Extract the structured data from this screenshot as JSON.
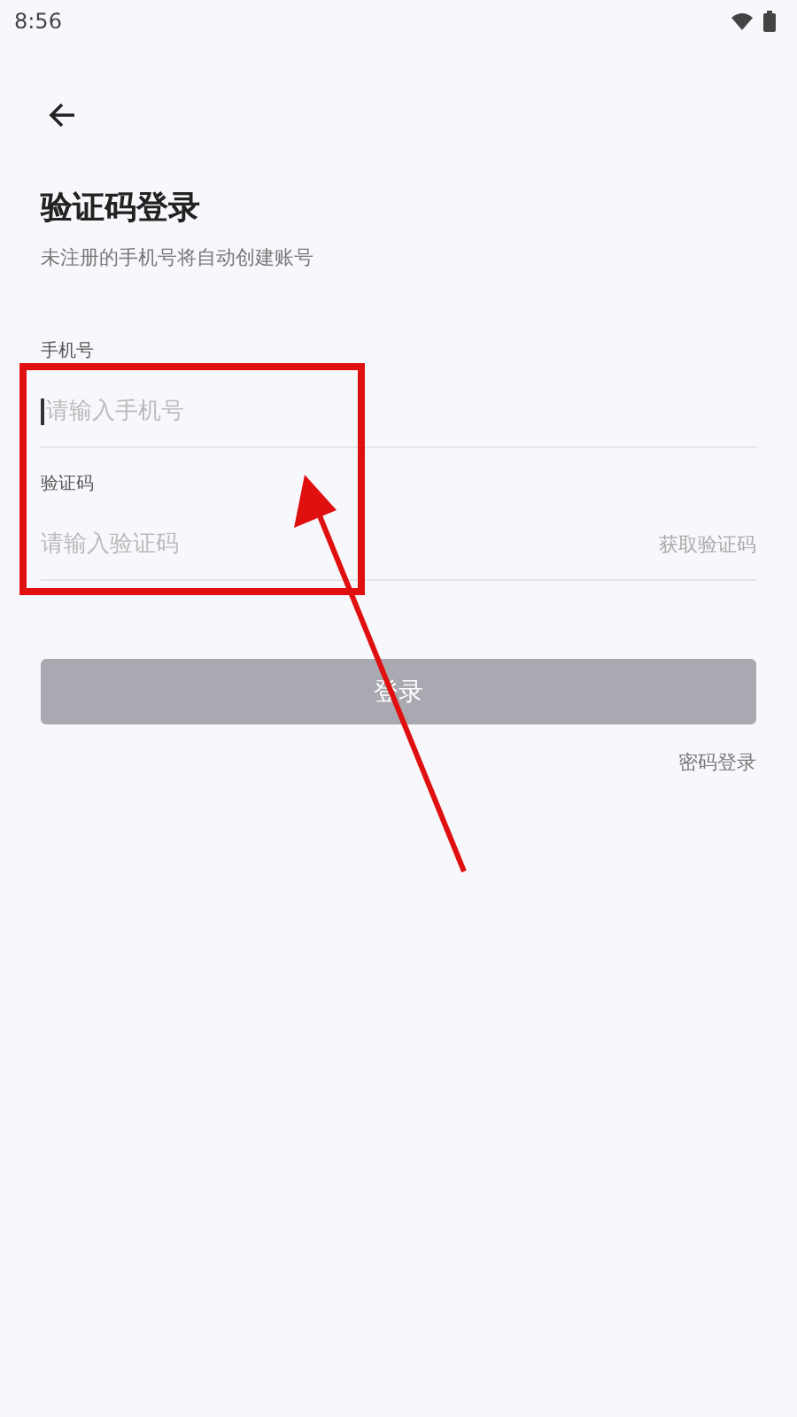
{
  "status_bar": {
    "time": "8:56"
  },
  "header": {
    "title": "验证码登录",
    "subtitle": "未注册的手机号将自动创建账号"
  },
  "fields": [
    {
      "label": "手机号",
      "placeholder": "请输入手机号",
      "focused": true
    },
    {
      "label": "验证码",
      "placeholder": "请输入验证码",
      "action": "获取验证码",
      "focused": false
    }
  ],
  "login_button": {
    "label": "登录",
    "disabled": true
  },
  "alt_link": "密码登录"
}
